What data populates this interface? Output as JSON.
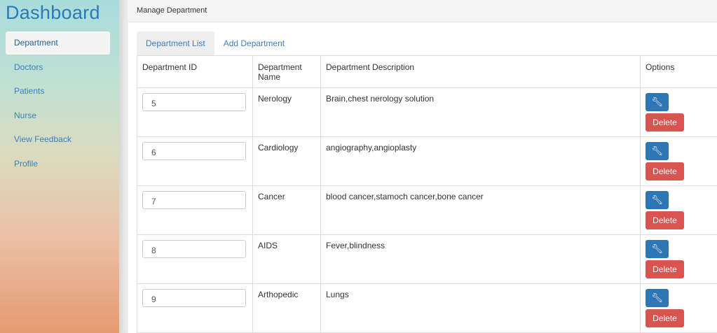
{
  "sidebar": {
    "brand": "Dashboard",
    "items": [
      {
        "label": "Department"
      },
      {
        "label": "Doctors"
      },
      {
        "label": "Patients"
      },
      {
        "label": "Nurse"
      },
      {
        "label": "View Feedback"
      },
      {
        "label": "Profile"
      }
    ],
    "active_index": 0
  },
  "header": {
    "title": "Manage Department"
  },
  "tabs": [
    {
      "label": "Department List"
    },
    {
      "label": "Add Department"
    }
  ],
  "table": {
    "headers": {
      "id": "Department ID",
      "name": "Department Name",
      "description": "Department Description",
      "options": "Options"
    },
    "rows": [
      {
        "id": "5",
        "name": "Nerology",
        "description": "Brain,chest nerology solution"
      },
      {
        "id": "6",
        "name": "Cardiology",
        "description": "angiography,angioplasty"
      },
      {
        "id": "7",
        "name": "Cancer",
        "description": "blood cancer,stamoch cancer,bone cancer"
      },
      {
        "id": "8",
        "name": "AIDS",
        "description": "Fever,blindness"
      },
      {
        "id": "9",
        "name": "Arthopedic",
        "description": "Lungs"
      }
    ],
    "delete_label": "Delete",
    "edit_icon": "wrench-icon"
  },
  "colors": {
    "brand": "#2a7ab7",
    "link": "#3d7fc4",
    "edit_button": "#2f76b5",
    "delete_button": "#d9534f"
  }
}
